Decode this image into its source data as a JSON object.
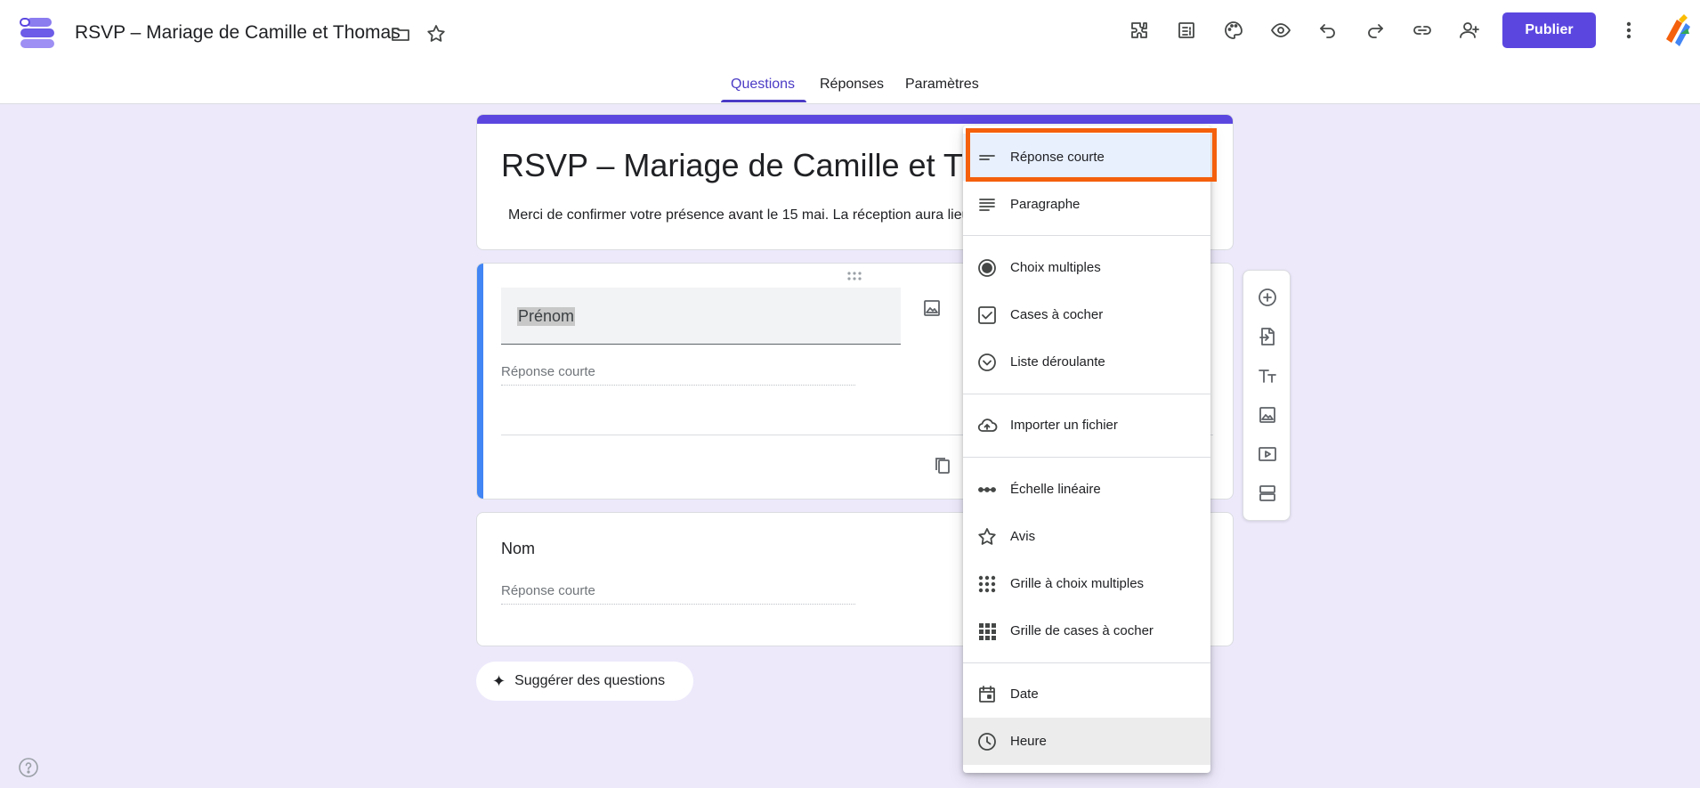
{
  "app": {
    "doc_title": "RSVP – Mariage de Camille et Thomas",
    "publish_label": "Publier"
  },
  "header_icons": [
    "folder-icon",
    "star-icon",
    "addons-icon",
    "response-sheet-icon",
    "palette-icon",
    "preview-eye-icon",
    "undo-icon",
    "redo-icon",
    "link-icon",
    "add-collaborator-icon",
    "more-vert-icon"
  ],
  "tabs": [
    {
      "label": "Questions",
      "active": true
    },
    {
      "label": "Réponses",
      "active": false
    },
    {
      "label": "Paramètres",
      "active": false
    }
  ],
  "form": {
    "title": "RSVP – Mariage de Camille et Thomas",
    "description": "Merci de confirmer votre présence avant le 15 mai. La réception aura lieu"
  },
  "questions": [
    {
      "title": "Prénom",
      "answer_placeholder": "Réponse courte"
    },
    {
      "title": "Nom",
      "answer_placeholder": "Réponse courte"
    }
  ],
  "suggest_label": "Suggérer des questions",
  "toolbar": [
    "add-question-icon",
    "import-questions-icon",
    "add-title-icon",
    "add-image-icon",
    "add-video-icon",
    "add-section-icon"
  ],
  "menu": {
    "items": [
      {
        "label": "Réponse courte",
        "icon": "short-answer-icon",
        "state": "selected"
      },
      {
        "label": "Paragraphe",
        "icon": "paragraph-icon"
      },
      {
        "label": "Choix multiples",
        "icon": "radio-icon"
      },
      {
        "label": "Cases à cocher",
        "icon": "checkbox-icon"
      },
      {
        "label": "Liste déroulante",
        "icon": "dropdown-icon"
      },
      {
        "label": "Importer un fichier",
        "icon": "cloud-upload-icon"
      },
      {
        "label": "Échelle linéaire",
        "icon": "linear-scale-icon"
      },
      {
        "label": "Avis",
        "icon": "star-icon"
      },
      {
        "label": "Grille à choix multiples",
        "icon": "grid-dots-icon"
      },
      {
        "label": "Grille de cases à cocher",
        "icon": "grid-squares-icon"
      },
      {
        "label": "Date",
        "icon": "calendar-icon"
      },
      {
        "label": "Heure",
        "icon": "clock-icon",
        "state": "hover"
      }
    ]
  },
  "colors": {
    "accent": "#5b47e0",
    "background": "#ede9fb",
    "active_question_bar": "#4285f4",
    "highlight": "#f4600c"
  }
}
